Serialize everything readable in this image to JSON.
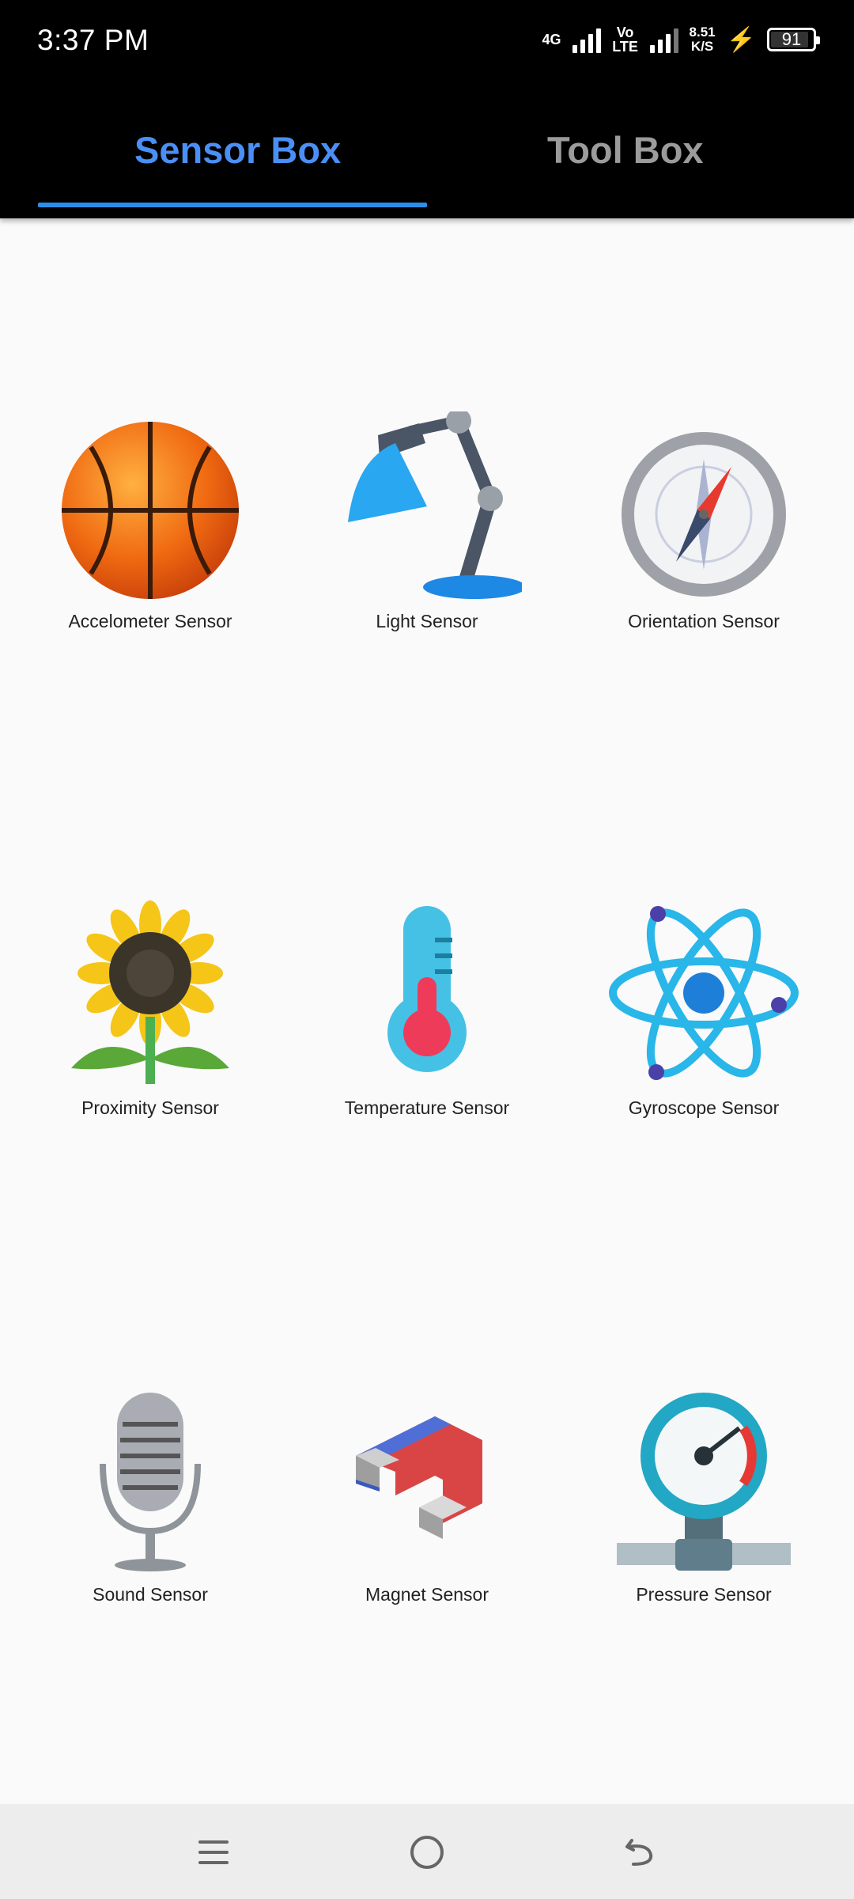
{
  "status": {
    "time": "3:37 PM",
    "network1": "4G",
    "network2": "Vo LTE",
    "speed_value": "8.51",
    "speed_unit": "K/S",
    "battery_level": "91"
  },
  "tabs": [
    {
      "label": "Sensor Box",
      "selected": true
    },
    {
      "label": "Tool Box",
      "selected": false
    }
  ],
  "sensors": [
    {
      "label": "Accelometer Sensor",
      "icon": "basketball-icon"
    },
    {
      "label": "Light Sensor",
      "icon": "desk-lamp-icon"
    },
    {
      "label": "Orientation Sensor",
      "icon": "compass-icon"
    },
    {
      "label": "Proximity Sensor",
      "icon": "sunflower-icon"
    },
    {
      "label": "Temperature Sensor",
      "icon": "thermometer-icon"
    },
    {
      "label": "Gyroscope Sensor",
      "icon": "atom-icon"
    },
    {
      "label": "Sound Sensor",
      "icon": "microphone-icon"
    },
    {
      "label": "Magnet Sensor",
      "icon": "magnet-icon"
    },
    {
      "label": "Pressure Sensor",
      "icon": "pressure-gauge-icon"
    }
  ],
  "navigation": [
    "menu-icon",
    "home-icon",
    "back-icon"
  ],
  "colors": {
    "accent": "#4a8ff5",
    "indicator": "#2b8fe8",
    "tab_inactive": "#9b9b9b",
    "background": "#fafafa"
  }
}
